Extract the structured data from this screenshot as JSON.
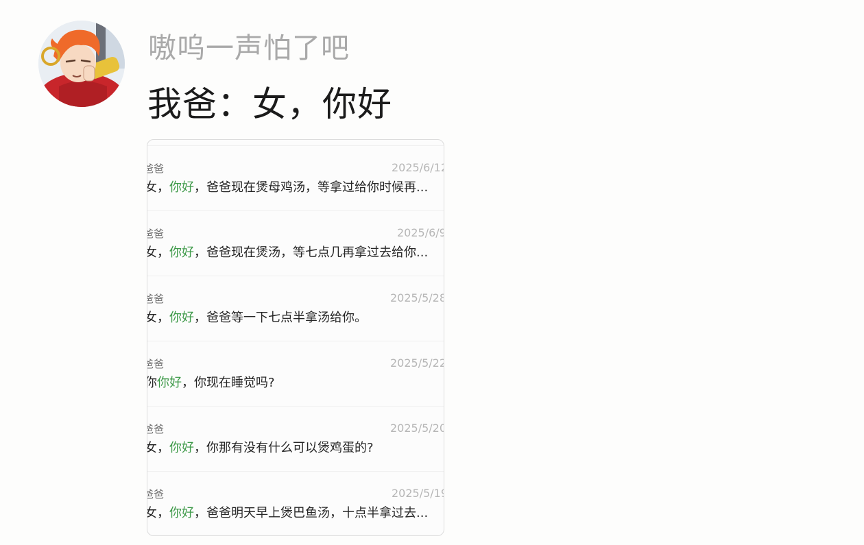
{
  "post": {
    "username": "嗷呜一声怕了吧",
    "text": "我爸：女，你好"
  },
  "messages": [
    {
      "sender": "爸爸",
      "date": "2025/6/12",
      "before": "女，",
      "highlight": "你好",
      "after": "，爸爸现在煲母鸡汤，等拿过给你时候再..."
    },
    {
      "sender": "爸爸",
      "date": "2025/6/9",
      "before": "女，",
      "highlight": "你好",
      "after": "，爸爸现在煲汤，等七点几再拿过去给你..."
    },
    {
      "sender": "爸爸",
      "date": "2025/5/28",
      "before": "女，",
      "highlight": "你好",
      "after": "，爸爸等一下七点半拿汤给你。"
    },
    {
      "sender": "爸爸",
      "date": "2025/5/22",
      "before": "你",
      "highlight": "你好",
      "after": "，你现在睡觉吗?"
    },
    {
      "sender": "爸爸",
      "date": "2025/5/20",
      "before": "女，",
      "highlight": "你好",
      "after": "，你那有没有什么可以煲鸡蛋的?"
    },
    {
      "sender": "爸爸",
      "date": "2025/5/19",
      "before": "女，",
      "highlight": "你好",
      "after": "，爸爸明天早上煲巴鱼汤，十点半拿过去..."
    }
  ],
  "colors": {
    "highlight": "#3f9a4a",
    "username": "#a9a9a9"
  },
  "icons": {
    "avatar": "avatar-image"
  }
}
